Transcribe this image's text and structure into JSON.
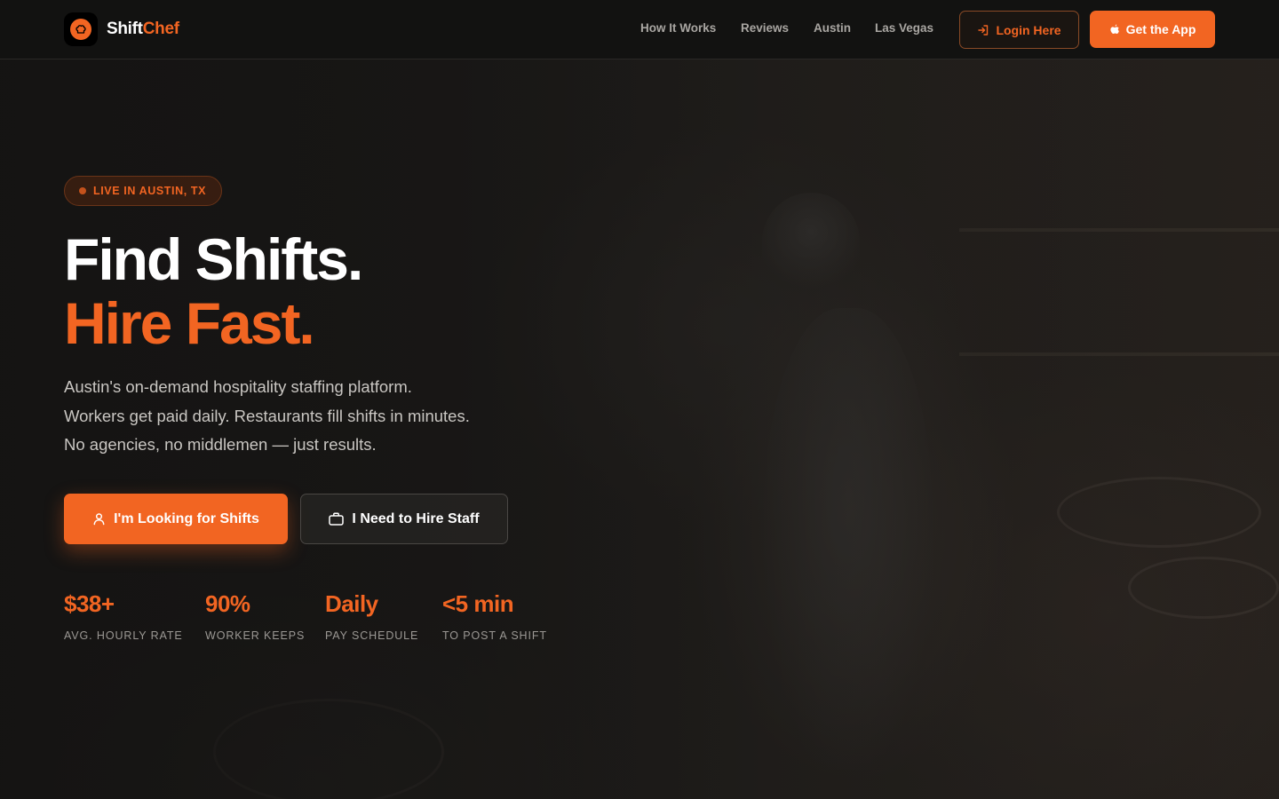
{
  "brand": {
    "name_part1": "Shift",
    "name_part2": "Chef",
    "logo_icon": "chef-hat-icon"
  },
  "nav": {
    "links": [
      "How It Works",
      "Reviews",
      "Austin",
      "Las Vegas"
    ],
    "login_label": "Login Here",
    "app_label": "Get the App"
  },
  "hero": {
    "badge": "LIVE IN AUSTIN, TX",
    "headline_line1": "Find Shifts.",
    "headline_line2": "Hire Fast.",
    "subtext": [
      "Austin's on-demand hospitality staffing platform.",
      "Workers get paid daily. Restaurants fill shifts in minutes.",
      "No agencies, no middlemen — just results."
    ],
    "cta_primary": "I'm Looking for Shifts",
    "cta_secondary": "I Need to Hire Staff"
  },
  "stats": [
    {
      "value": "$38+",
      "label": "AVG. HOURLY RATE"
    },
    {
      "value": "90%",
      "label": "WORKER KEEPS"
    },
    {
      "value": "Daily",
      "label": "PAY SCHEDULE"
    },
    {
      "value": "<5 min",
      "label": "TO POST A SHIFT"
    }
  ],
  "colors": {
    "accent": "#f26522",
    "background": "#141312",
    "navbar": "#121211"
  }
}
